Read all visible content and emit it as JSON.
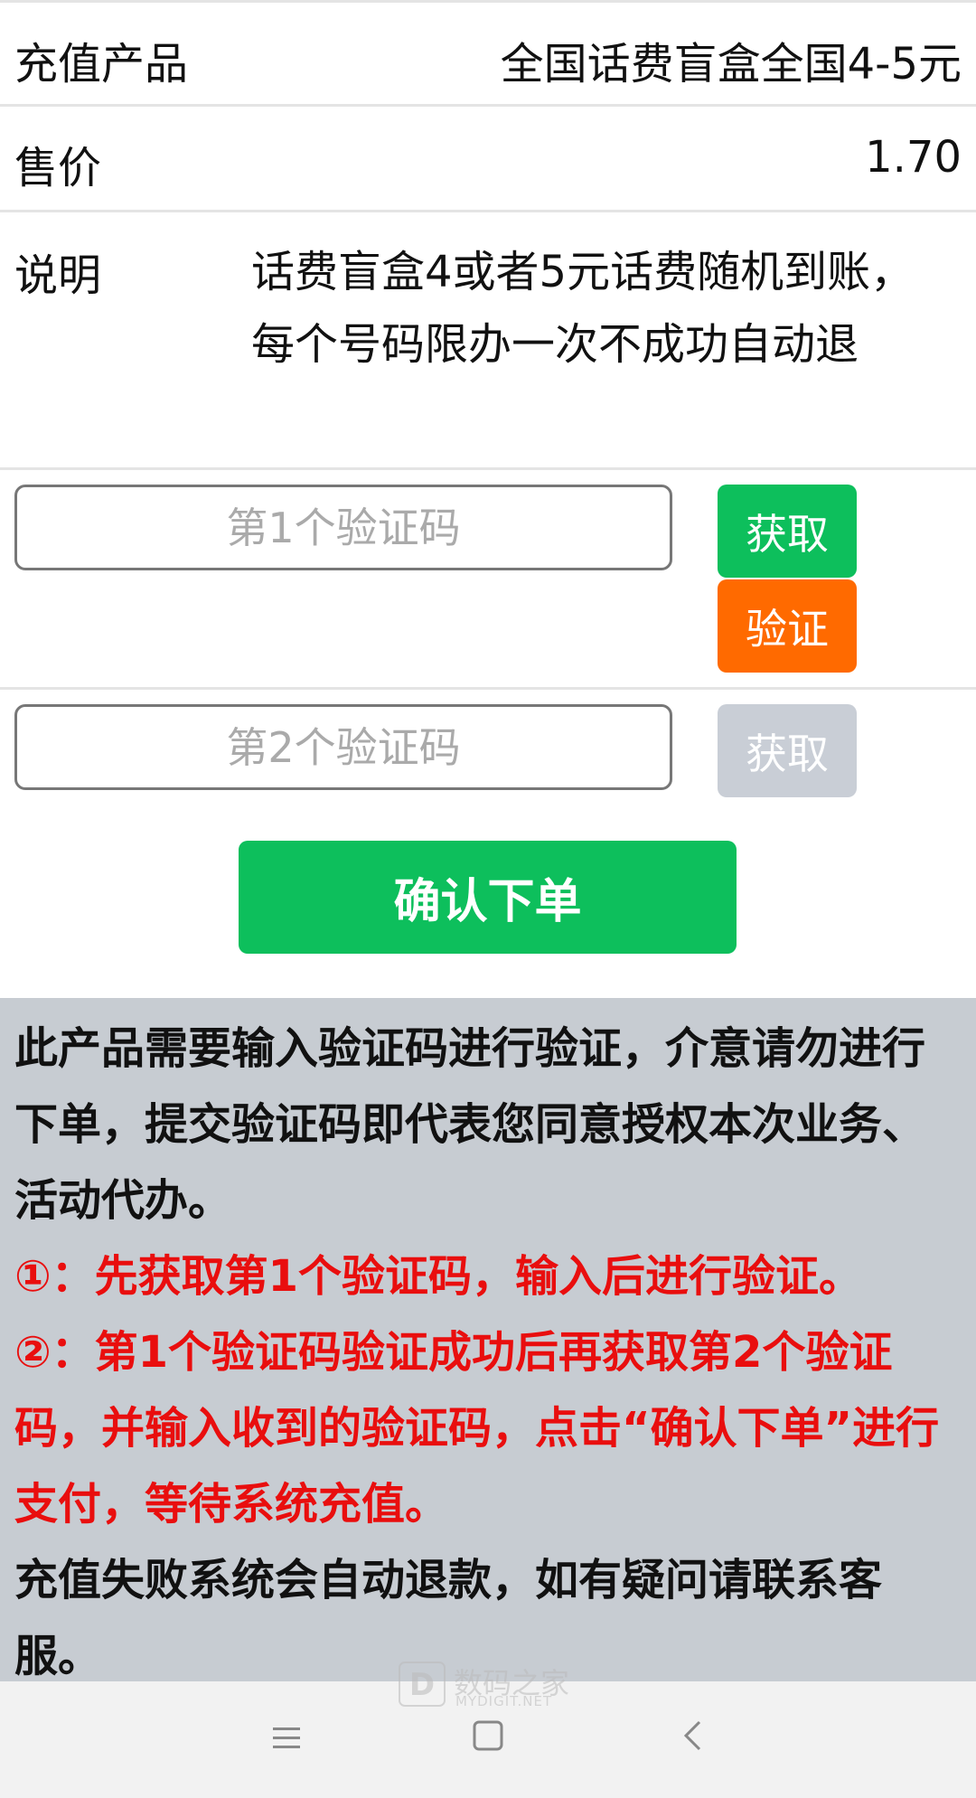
{
  "product": {
    "label": "充值产品",
    "value": "全国话费盲盒全国4-5元"
  },
  "price": {
    "label": "售价",
    "value": "1.70"
  },
  "description": {
    "label": "说明",
    "text": "话费盲盒4或者5元话费随机到账，每个号码限办一次不成功自动退"
  },
  "code1": {
    "placeholder": "第1个验证码",
    "value": "",
    "get_label": "获取",
    "verify_label": "验证"
  },
  "code2": {
    "placeholder": "第2个验证码",
    "value": "",
    "get_label": "获取"
  },
  "confirm_label": "确认下单",
  "notice": {
    "intro": "此产品需要输入验证码进行验证，介意请勿进行下单，提交验证码即代表您同意授权本次业务、活动代办。",
    "step1": "①：先获取第1个验证码，输入后进行验证。",
    "step2": "②：第1个验证码验证成功后再获取第2个验证码，并输入收到的验证码，点击“确认下单”进行支付，等待系统充值。",
    "footer": "充值失败系统会自动退款，如有疑问请联系客服。"
  },
  "watermark": {
    "cn": "数码之家",
    "en": "MYDIGIT.NET"
  },
  "navbar": {
    "icons": [
      "menu-icon",
      "home-square-icon",
      "back-chevron-icon"
    ]
  },
  "colors": {
    "green": "#0dbf5c",
    "orange": "#ff6a00",
    "disabled": "#c9ced6",
    "notice_bg": "#c7ccd2",
    "notice_red": "#e90e0e"
  }
}
